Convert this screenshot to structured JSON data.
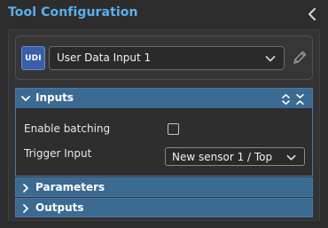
{
  "panel": {
    "title": "Tool Configuration",
    "accent_color": "#5ab0f0"
  },
  "tool": {
    "icon_label": "UDI",
    "selected": "User Data Input 1"
  },
  "sections": {
    "inputs": {
      "title": "Inputs",
      "expanded": true,
      "enable_batching_label": "Enable batching",
      "enable_batching_checked": false,
      "trigger_input_label": "Trigger Input",
      "trigger_input_value": "New sensor 1 / Top"
    },
    "parameters": {
      "title": "Parameters",
      "expanded": false
    },
    "outputs": {
      "title": "Outputs",
      "expanded": false
    }
  },
  "icons": {
    "collapse_panel": "chevron-left-icon",
    "tool_dropdown": "chevron-down-icon",
    "edit": "pencil-icon",
    "section_expanded": "chevron-down-icon",
    "section_collapsed": "chevron-right-icon",
    "expand_all": "expand-all-icon",
    "collapse_all": "collapse-all-icon"
  }
}
